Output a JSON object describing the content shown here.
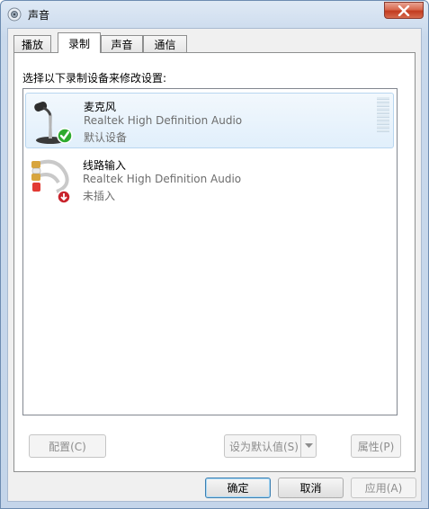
{
  "window": {
    "title": "声音"
  },
  "tabs": [
    {
      "label": "播放",
      "active": false
    },
    {
      "label": "录制",
      "active": true
    },
    {
      "label": "声音",
      "active": false
    },
    {
      "label": "通信",
      "active": false
    }
  ],
  "instruction": "选择以下录制设备来修改设置:",
  "devices": [
    {
      "name": "麦克风",
      "driver": "Realtek High Definition Audio",
      "status": "默认设备",
      "icon": "microphone-icon",
      "badge": "default-check-icon",
      "selected": true
    },
    {
      "name": "线路输入",
      "driver": "Realtek High Definition Audio",
      "status": "未插入",
      "icon": "line-in-cable-icon",
      "badge": "unplugged-down-arrow-icon",
      "selected": false
    }
  ],
  "panel_buttons": {
    "configure": "配置(C)",
    "set_default": "设为默认值(S)",
    "properties": "属性(P)"
  },
  "dialog_buttons": {
    "ok": "确定",
    "cancel": "取消",
    "apply": "应用(A)"
  },
  "colors": {
    "selection_bg": "#e1effb",
    "check_green": "#2eaa2e",
    "unplugged_red": "#c8232c"
  }
}
